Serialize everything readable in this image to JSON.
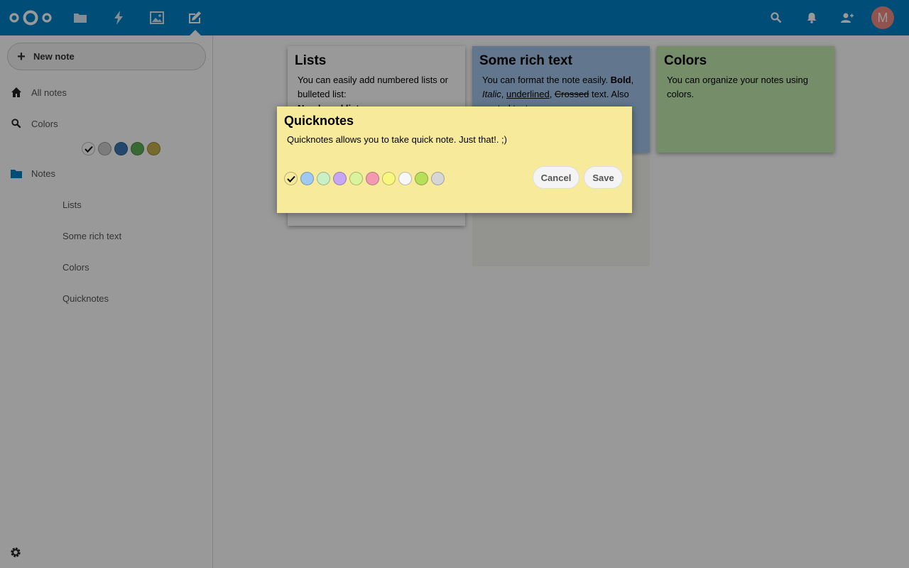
{
  "header": {
    "apps": [
      "files-icon",
      "activity-icon",
      "gallery-icon",
      "notes-icon"
    ],
    "avatar_initial": "M"
  },
  "sidebar": {
    "new_note_label": "New note",
    "all_notes_label": "All notes",
    "colors_label": "Colors",
    "filter_colors": [
      "#1e1e1e",
      "#cfcfcf",
      "#3b79b5",
      "#5fb15a",
      "#c8b04d"
    ],
    "notes_label": "Notes",
    "notes": [
      "Lists",
      "Some rich text",
      "Colors",
      "Quicknotes"
    ]
  },
  "cards": [
    {
      "title": "Lists",
      "color": "#ffffff",
      "lines": [
        "You can easily add numbered lists or bulleted list:",
        "Numbered lists:"
      ]
    },
    {
      "title": "Some rich text",
      "color": "#a3c7ec",
      "text_before": "You can format the note easily. ",
      "bold": "Bold",
      "sep1": ", ",
      "italic": "Italic",
      "sep2": ", ",
      "underlined": "underlined",
      "sep3": ", ",
      "crossed": "Crossed",
      "text_after": " text. Also quoted text."
    },
    {
      "title": "Colors",
      "color": "#c4ecb0",
      "lines": [
        "You can organize your notes using colors."
      ]
    }
  ],
  "modal": {
    "title": "Quicknotes",
    "body": "Quicknotes allows you to take quick note. Just that!. ;)",
    "colors": [
      "#f7ea9b",
      "#9fc9f2",
      "#c9efc6",
      "#c7a6f4",
      "#d9f49a",
      "#f39ab0",
      "#f9f780",
      "#f7f7f7",
      "#b9de5a",
      "#d6d6d6"
    ],
    "cancel_label": "Cancel",
    "save_label": "Save"
  }
}
